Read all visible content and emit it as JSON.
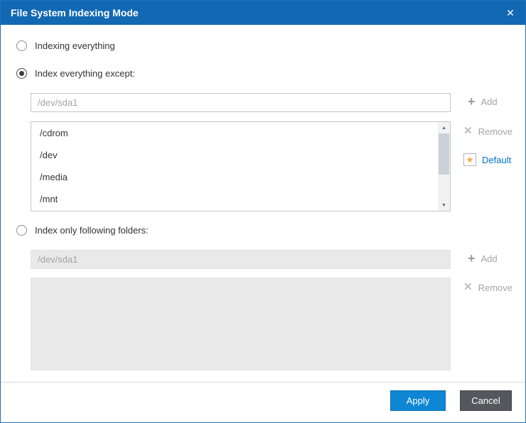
{
  "dialog": {
    "title": "File System Indexing Mode"
  },
  "icons": {
    "close": "✕",
    "plus": "+",
    "remove": "✕",
    "star": "★",
    "scroll_up": "▲",
    "scroll_down": "▼"
  },
  "options": {
    "everything": {
      "label": "Indexing everything",
      "selected": false
    },
    "except": {
      "label": "Index everything except:",
      "selected": true
    },
    "only": {
      "label": "Index only following folders:",
      "selected": false
    }
  },
  "except_section": {
    "input_value": "",
    "input_placeholder": "/dev/sda1",
    "add_label": "Add",
    "remove_label": "Remove",
    "default_label": "Default",
    "list_items": [
      "/cdrom",
      "/dev",
      "/media",
      "/mnt"
    ]
  },
  "only_section": {
    "input_value": "",
    "input_placeholder": "/dev/sda1",
    "add_label": "Add",
    "remove_label": "Remove",
    "list_items": []
  },
  "footer": {
    "apply_label": "Apply",
    "cancel_label": "Cancel"
  },
  "colors": {
    "title_bar": "#1268b3",
    "apply_button": "#0e86d4",
    "cancel_button": "#54575c",
    "default_link": "#0072c6",
    "star": "#f2a53a"
  }
}
